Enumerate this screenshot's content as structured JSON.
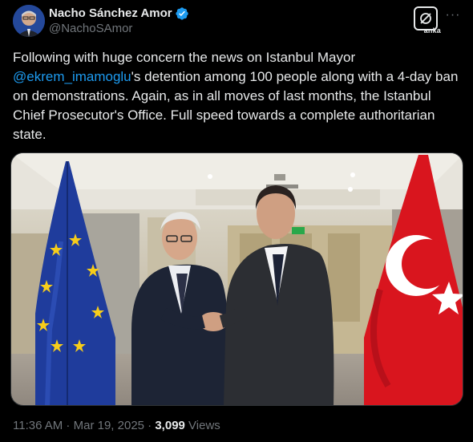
{
  "author": {
    "display_name": "Nacho Sánchez Amor",
    "handle": "@NachoSAmor",
    "verified": true
  },
  "actions": {
    "grok_label": "anka",
    "more_icon": "more-dots-icon"
  },
  "tweet": {
    "text_before": "Following with huge concern the news on Istanbul Mayor ",
    "mention": "@ekrem_imamoglu",
    "text_after": "'s detention among 100 people along with a 4-day ban on demonstrations. Again, as in all moves of last months, the Istanbul Chief Prosecutor's Office. Full speed towards a complete authoritarian state."
  },
  "meta": {
    "time": "11:36 AM",
    "separator": " · ",
    "date": "Mar 19, 2025",
    "views_count": "3,099",
    "views_label": " Views"
  },
  "colors": {
    "accent": "#1d9bf0",
    "text": "#e7e9ea",
    "muted": "#71767b",
    "background": "#000000"
  }
}
